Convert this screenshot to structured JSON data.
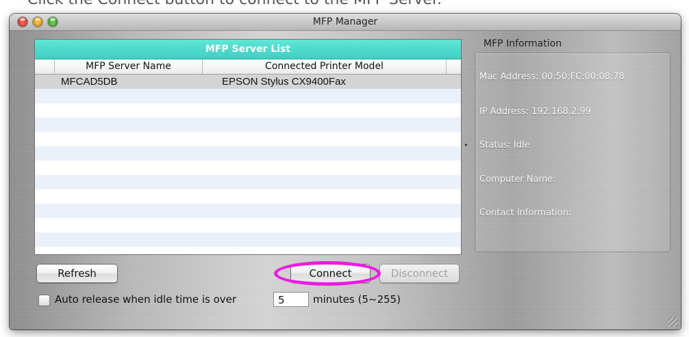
{
  "caption": "Click the Connect button to connect to the MFP Server.",
  "window": {
    "title": "MFP Manager"
  },
  "server_list": {
    "title": "MFP Server List",
    "columns": [
      "MFP Server Name",
      "Connected Printer Model"
    ],
    "rows": [
      {
        "name": "MFCAD5DB",
        "model": "EPSON Stylus CX9400Fax"
      },
      {
        "name": "",
        "model": ""
      },
      {
        "name": "",
        "model": ""
      },
      {
        "name": "",
        "model": ""
      },
      {
        "name": "",
        "model": ""
      },
      {
        "name": "",
        "model": ""
      },
      {
        "name": "",
        "model": ""
      },
      {
        "name": "",
        "model": ""
      },
      {
        "name": "",
        "model": ""
      },
      {
        "name": "",
        "model": ""
      },
      {
        "name": "",
        "model": ""
      },
      {
        "name": "",
        "model": ""
      }
    ]
  },
  "info": {
    "label": "MFP Information",
    "mac": "Mac Address: 00:50:FC:00:08:78",
    "ip": "IP Address: 192.168.2.99",
    "status": "Status: Idle",
    "computer_name": "Computer Name:",
    "contact": "Contact Information:"
  },
  "buttons": {
    "refresh": "Refresh",
    "connect": "Connect",
    "disconnect": "Disconnect"
  },
  "auto_release": {
    "label": "Auto release when idle time is over",
    "value": "5",
    "suffix": "minutes (5~255)",
    "checked": false
  },
  "colors": {
    "list_header": "#4ad8c9",
    "highlight_ring": "#ee19e3"
  }
}
